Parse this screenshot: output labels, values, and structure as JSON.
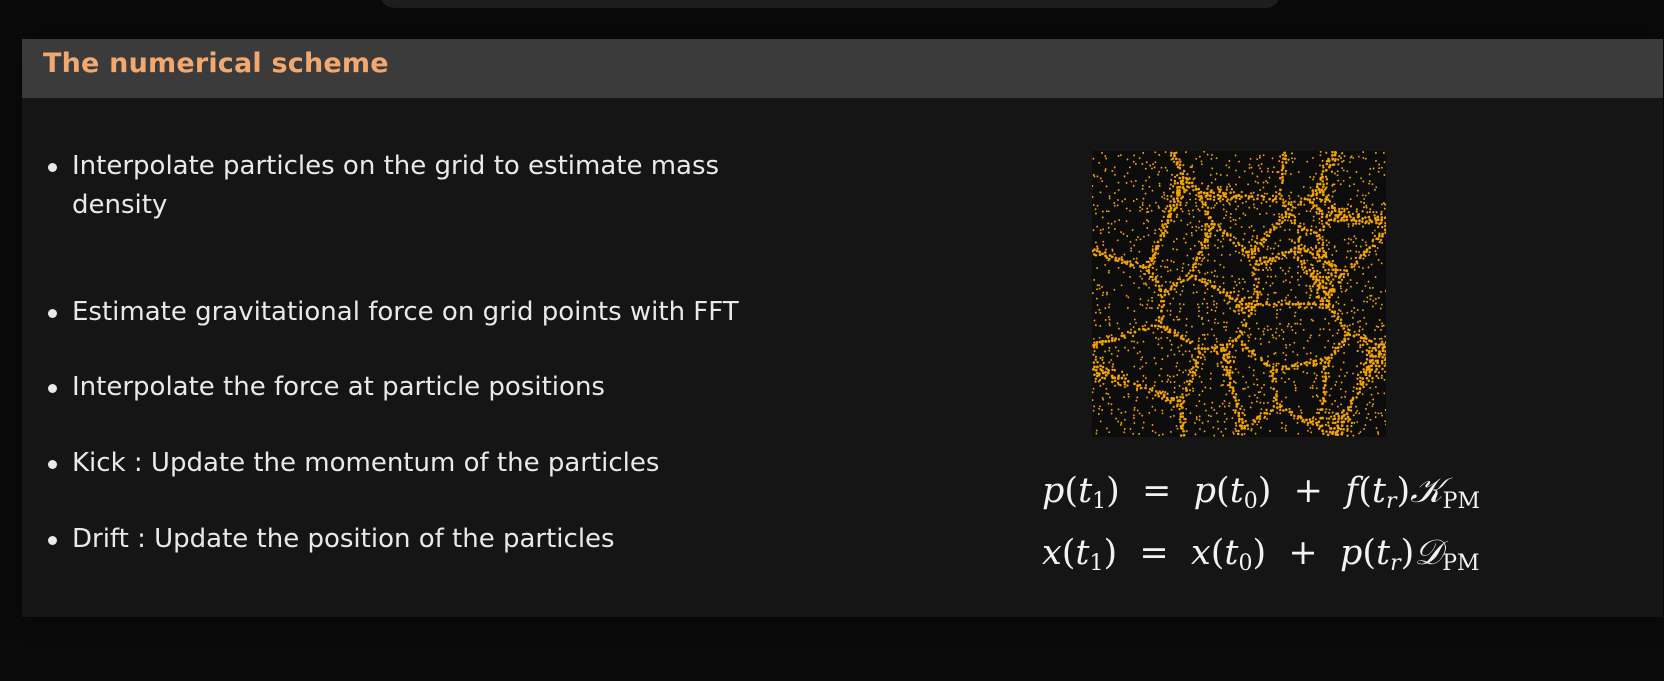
{
  "slide": {
    "title": "The numerical scheme",
    "bullets": [
      "Interpolate particles on the grid to estimate mass density",
      "Estimate gravitational force on grid points with FFT",
      "Interpolate the force at particle positions",
      "Kick : Update the momentum of the particles",
      "Drift : Update the position of the particles"
    ],
    "equations": {
      "kick": {
        "lhs": "p",
        "lhs_arg": "t",
        "lhs_sub": "1",
        "rhs_1": "p",
        "rhs_1_arg": "t",
        "rhs_1_sub": "0",
        "rhs_2": "f",
        "rhs_2_arg": "t",
        "rhs_2_sub": "r",
        "operator": "𝒦",
        "operator_sub": "PM"
      },
      "drift": {
        "lhs": "x",
        "lhs_arg": "t",
        "lhs_sub": "1",
        "rhs_1": "x",
        "rhs_1_arg": "t",
        "rhs_1_sub": "0",
        "rhs_2": "p",
        "rhs_2_arg": "t",
        "rhs_2_sub": "r",
        "operator": "𝒟",
        "operator_sub": "PM"
      }
    }
  },
  "particle_image": {
    "description_icon": "particle-simulation-image",
    "particle_color": "#f5a300",
    "background_color": "#0c0c0c"
  },
  "colors": {
    "title": "#f2a86e",
    "header_bar": "#3b3b3b",
    "slide_background": "#151515",
    "text": "#e9e9e9"
  }
}
